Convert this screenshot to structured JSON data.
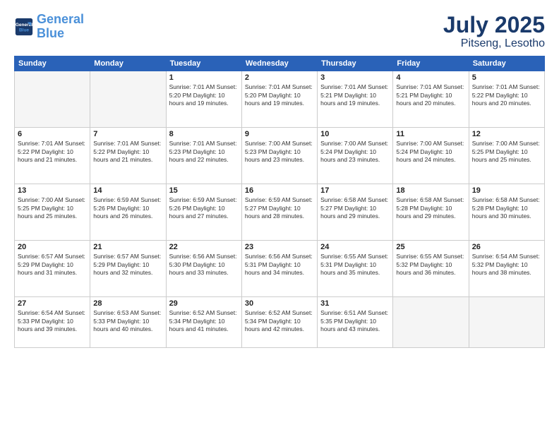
{
  "header": {
    "logo_line1": "General",
    "logo_line2": "Blue",
    "month": "July 2025",
    "location": "Pitseng, Lesotho"
  },
  "weekdays": [
    "Sunday",
    "Monday",
    "Tuesday",
    "Wednesday",
    "Thursday",
    "Friday",
    "Saturday"
  ],
  "weeks": [
    [
      {
        "day": "",
        "content": ""
      },
      {
        "day": "",
        "content": ""
      },
      {
        "day": "1",
        "content": "Sunrise: 7:01 AM\nSunset: 5:20 PM\nDaylight: 10 hours\nand 19 minutes."
      },
      {
        "day": "2",
        "content": "Sunrise: 7:01 AM\nSunset: 5:20 PM\nDaylight: 10 hours\nand 19 minutes."
      },
      {
        "day": "3",
        "content": "Sunrise: 7:01 AM\nSunset: 5:21 PM\nDaylight: 10 hours\nand 19 minutes."
      },
      {
        "day": "4",
        "content": "Sunrise: 7:01 AM\nSunset: 5:21 PM\nDaylight: 10 hours\nand 20 minutes."
      },
      {
        "day": "5",
        "content": "Sunrise: 7:01 AM\nSunset: 5:22 PM\nDaylight: 10 hours\nand 20 minutes."
      }
    ],
    [
      {
        "day": "6",
        "content": "Sunrise: 7:01 AM\nSunset: 5:22 PM\nDaylight: 10 hours\nand 21 minutes."
      },
      {
        "day": "7",
        "content": "Sunrise: 7:01 AM\nSunset: 5:22 PM\nDaylight: 10 hours\nand 21 minutes."
      },
      {
        "day": "8",
        "content": "Sunrise: 7:01 AM\nSunset: 5:23 PM\nDaylight: 10 hours\nand 22 minutes."
      },
      {
        "day": "9",
        "content": "Sunrise: 7:00 AM\nSunset: 5:23 PM\nDaylight: 10 hours\nand 23 minutes."
      },
      {
        "day": "10",
        "content": "Sunrise: 7:00 AM\nSunset: 5:24 PM\nDaylight: 10 hours\nand 23 minutes."
      },
      {
        "day": "11",
        "content": "Sunrise: 7:00 AM\nSunset: 5:24 PM\nDaylight: 10 hours\nand 24 minutes."
      },
      {
        "day": "12",
        "content": "Sunrise: 7:00 AM\nSunset: 5:25 PM\nDaylight: 10 hours\nand 25 minutes."
      }
    ],
    [
      {
        "day": "13",
        "content": "Sunrise: 7:00 AM\nSunset: 5:25 PM\nDaylight: 10 hours\nand 25 minutes."
      },
      {
        "day": "14",
        "content": "Sunrise: 6:59 AM\nSunset: 5:26 PM\nDaylight: 10 hours\nand 26 minutes."
      },
      {
        "day": "15",
        "content": "Sunrise: 6:59 AM\nSunset: 5:26 PM\nDaylight: 10 hours\nand 27 minutes."
      },
      {
        "day": "16",
        "content": "Sunrise: 6:59 AM\nSunset: 5:27 PM\nDaylight: 10 hours\nand 28 minutes."
      },
      {
        "day": "17",
        "content": "Sunrise: 6:58 AM\nSunset: 5:27 PM\nDaylight: 10 hours\nand 29 minutes."
      },
      {
        "day": "18",
        "content": "Sunrise: 6:58 AM\nSunset: 5:28 PM\nDaylight: 10 hours\nand 29 minutes."
      },
      {
        "day": "19",
        "content": "Sunrise: 6:58 AM\nSunset: 5:28 PM\nDaylight: 10 hours\nand 30 minutes."
      }
    ],
    [
      {
        "day": "20",
        "content": "Sunrise: 6:57 AM\nSunset: 5:29 PM\nDaylight: 10 hours\nand 31 minutes."
      },
      {
        "day": "21",
        "content": "Sunrise: 6:57 AM\nSunset: 5:29 PM\nDaylight: 10 hours\nand 32 minutes."
      },
      {
        "day": "22",
        "content": "Sunrise: 6:56 AM\nSunset: 5:30 PM\nDaylight: 10 hours\nand 33 minutes."
      },
      {
        "day": "23",
        "content": "Sunrise: 6:56 AM\nSunset: 5:31 PM\nDaylight: 10 hours\nand 34 minutes."
      },
      {
        "day": "24",
        "content": "Sunrise: 6:55 AM\nSunset: 5:31 PM\nDaylight: 10 hours\nand 35 minutes."
      },
      {
        "day": "25",
        "content": "Sunrise: 6:55 AM\nSunset: 5:32 PM\nDaylight: 10 hours\nand 36 minutes."
      },
      {
        "day": "26",
        "content": "Sunrise: 6:54 AM\nSunset: 5:32 PM\nDaylight: 10 hours\nand 38 minutes."
      }
    ],
    [
      {
        "day": "27",
        "content": "Sunrise: 6:54 AM\nSunset: 5:33 PM\nDaylight: 10 hours\nand 39 minutes."
      },
      {
        "day": "28",
        "content": "Sunrise: 6:53 AM\nSunset: 5:33 PM\nDaylight: 10 hours\nand 40 minutes."
      },
      {
        "day": "29",
        "content": "Sunrise: 6:52 AM\nSunset: 5:34 PM\nDaylight: 10 hours\nand 41 minutes."
      },
      {
        "day": "30",
        "content": "Sunrise: 6:52 AM\nSunset: 5:34 PM\nDaylight: 10 hours\nand 42 minutes."
      },
      {
        "day": "31",
        "content": "Sunrise: 6:51 AM\nSunset: 5:35 PM\nDaylight: 10 hours\nand 43 minutes."
      },
      {
        "day": "",
        "content": ""
      },
      {
        "day": "",
        "content": ""
      }
    ]
  ]
}
